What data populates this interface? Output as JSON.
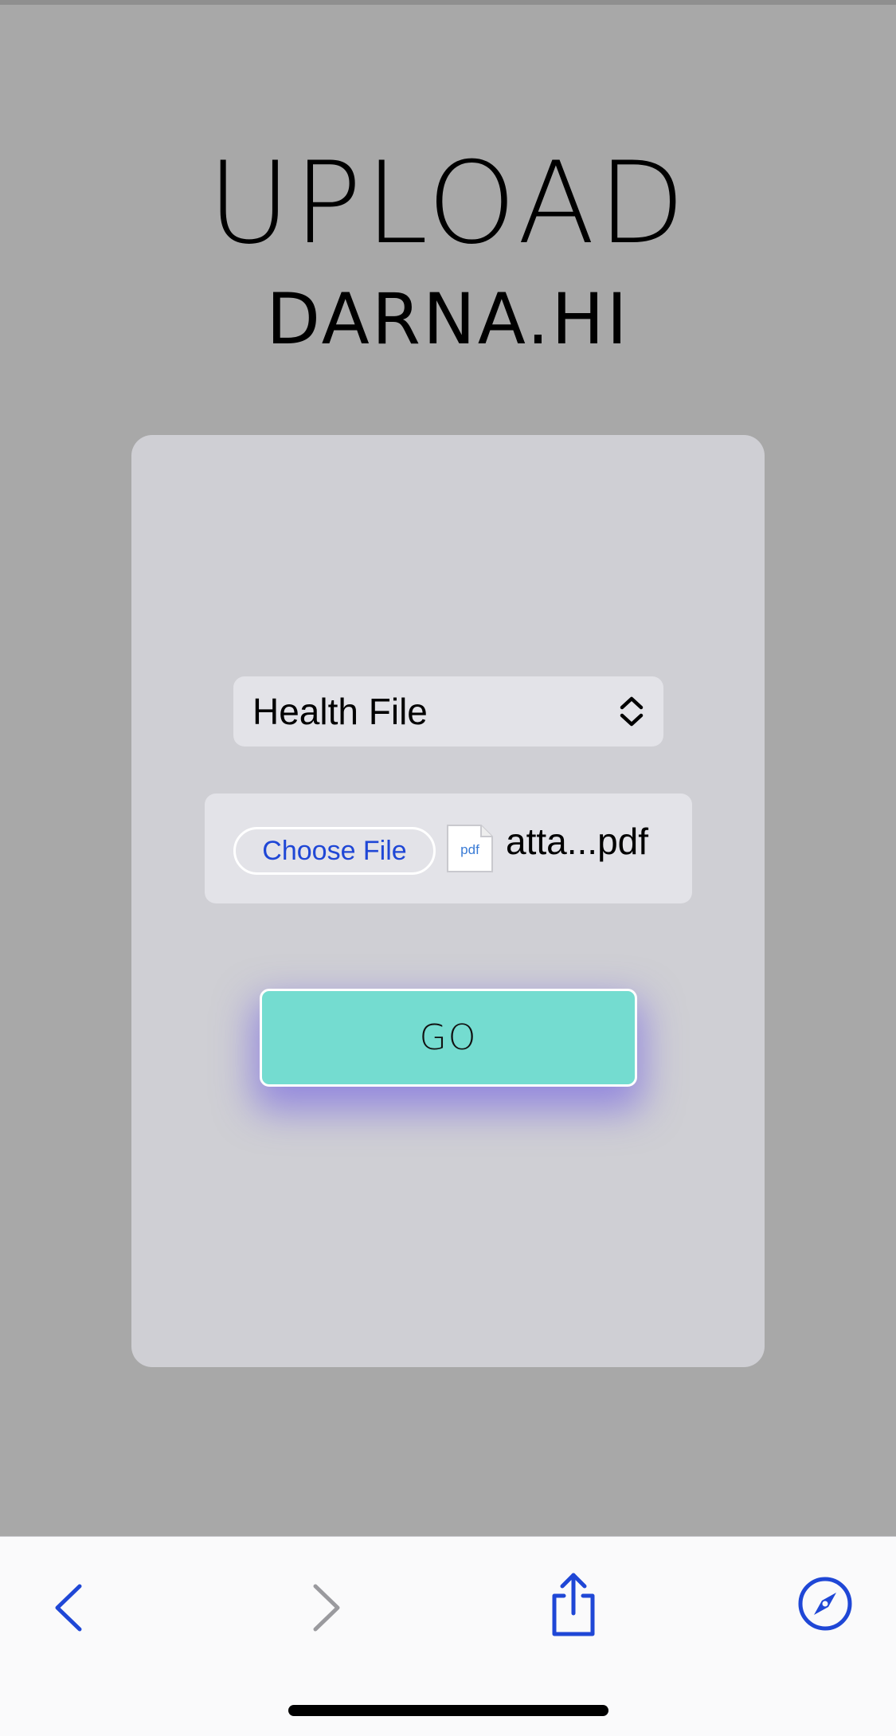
{
  "page": {
    "title": "UPLOAD",
    "subtitle": "DARNA.HI"
  },
  "form": {
    "file_type_select": {
      "selected": "Health File"
    },
    "file_input": {
      "button_label": "Choose File",
      "file_icon_label": "pdf",
      "file_name": "atta...pdf"
    },
    "submit_label": "GO"
  },
  "browser_toolbar": {
    "icons": [
      "chevron-left-icon",
      "chevron-right-icon",
      "share-icon",
      "compass-icon"
    ]
  },
  "colors": {
    "page_background": "#a8a8a8",
    "card_background": "#cfcfd4",
    "field_background": "#e3e3e8",
    "go_button": "#74dcd0",
    "go_button_glow": "#6450e6",
    "link_blue": "#1f47d6"
  }
}
